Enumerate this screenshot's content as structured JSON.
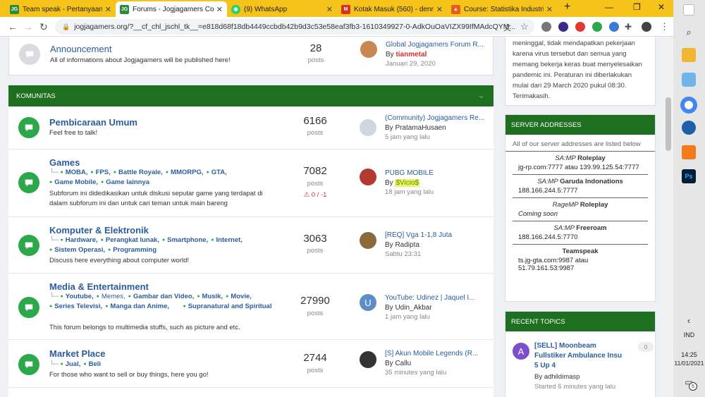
{
  "tabs": [
    {
      "label": "Team speak - Pertanyaan &",
      "icon": "jg-icon",
      "color": "#2e8b3a"
    },
    {
      "label": "Forums - Jogjagamers Com",
      "icon": "jg-icon",
      "color": "#2e8b3a"
    },
    {
      "label": "(9) WhatsApp",
      "icon": "whatsapp-icon",
      "color": "#25d366"
    },
    {
      "label": "Kotak Masuk (560) - denrio",
      "icon": "gmail-icon",
      "color": "#d93025"
    },
    {
      "label": "Course: Statistika Industri ke",
      "icon": "course-icon",
      "color": "#e85d1f"
    }
  ],
  "browser": {
    "url": "jogjagamers.org/?__cf_chl_jschl_tk__=e818d68f18db4449ccbdb42b9d3c53e58eaf3fb3-1610349927-0-AdkOuOaVIZX99IfMAdcQYM...",
    "new_tab": "+",
    "minimize": "—",
    "restore": "❐",
    "close": "✕"
  },
  "announcement": {
    "title": "Announcement",
    "desc": "All of informations about Jogjagamers will be published here!",
    "count": "28",
    "count_label": "posts",
    "last_title": "Global Jogjagamers Forum R...",
    "last_by": "By ",
    "last_user": "tianmetal",
    "last_time": "Januari 29, 2020"
  },
  "category": {
    "title": "KOMUNITAS"
  },
  "forums": [
    {
      "title": "Pembicaraan Umum",
      "desc": "Feel free to talk!",
      "subs": [],
      "count": "6166",
      "count_label": "posts",
      "last_title": "(Community) Jogjagamers Re...",
      "last_by": "By PratamaHusaen",
      "last_time": "5 jam yang lalu"
    },
    {
      "title": "Games",
      "desc": "Subforum ini didedikasikan untuk diskusi seputar game yang terdapat di dalam subforum ini dan untuk cari teman untuk main bareng",
      "subs": [
        "MOBA,",
        "FPS,",
        "Battle Royale,",
        "MMORPG,",
        "GTA,",
        "Game Mobile,",
        "Game lainnya"
      ],
      "count": "7082",
      "count_label": "posts",
      "rep": "0 / -1",
      "last_title": "PUBG MOBILE",
      "last_by": "By ",
      "last_user": "$Vicio$",
      "last_time": "18 jam yang lalu"
    },
    {
      "title": "Komputer & Elektronik",
      "desc": "Discuss here everything about computer world!",
      "subs": [
        "Hardware,",
        "Perangkat lunak,",
        "Smartphone,",
        "Internet,",
        "Sistem Operasi,",
        "Programming"
      ],
      "count": "3063",
      "count_label": "posts",
      "last_title": "[REQ] Vga 1-1,8 Juta",
      "last_by": "By Radipta",
      "last_time": "Sabtu 23:31"
    },
    {
      "title": "Media & Entertainment",
      "desc": "This forum belongs to multimedia stuffs, such as picture and etc.",
      "subs": [
        "Youtube,",
        "Memes,",
        "Gambar dan Video,",
        "Musik,",
        "Movie,",
        "Series Televisi,",
        "Manga dan Anime,",
        "Supranatural and Spiritual"
      ],
      "count": "27990",
      "count_label": "posts",
      "last_title": "YouTube: Udinez | Jaquel I...",
      "last_by": "By Udin_Akbar",
      "last_time": "1 jam yang lalu",
      "avatar_letter": "U"
    },
    {
      "title": "Market Place",
      "desc": "For those who want to sell or buy things, here you go!",
      "subs": [
        "Jual,",
        "Beli"
      ],
      "count": "2744",
      "count_label": "posts",
      "last_title": "[S] Akun Mobile Legends (R...",
      "last_by": "By Callu",
      "last_time": "35 minutes yang lalu"
    }
  ],
  "notice": "meninggal, tidak mendapatkan pekerjaan karena virus tersebut dan semua yang memang bekerja keras buat menyelesaikan pandemic ini. Peraturan ini diberlakukan mulai dari 29 March 2020 pukul 08:30. Terimakasih.",
  "servers": {
    "title": "SERVER ADDRESSES",
    "intro": "All of our server addresses are listed below",
    "items": [
      {
        "prefix": "SA:MP",
        "name": "Roleplay",
        "value": "jg-rp.com:7777 atau 139.99.125.54:7777"
      },
      {
        "prefix": "SA:MP",
        "name": "Garuda Indonations",
        "value": "188.166.244.5:7777"
      },
      {
        "prefix": "RageMP",
        "name": "Roleplay",
        "value": "Coming soon"
      },
      {
        "prefix": "SA:MP",
        "name": "Freeroam",
        "value": "188.166.244.5:7770"
      },
      {
        "prefix": "",
        "name": "Teamspeak",
        "value": "ts.jg-gta.com:9987 atau 51.79.161.53:9987"
      }
    ]
  },
  "recent": {
    "title": "RECENT TOPICS",
    "item": {
      "avatar": "A",
      "title": "[SELL] Moonbeam Fullstiker Ambulance Insu 5 Up 4",
      "by": "By adhildimasp",
      "time": "Started 6 minutes yang lalu",
      "count": "0"
    }
  },
  "taskbar": {
    "lang": "IND",
    "time": "14:25",
    "date": "11/01/2021",
    "notif": "5"
  },
  "colors": {
    "tabbar": "#f6c31a",
    "category": "#1e6f1f",
    "forum_icon": "#2aa84a",
    "link": "#2b5d9c"
  }
}
